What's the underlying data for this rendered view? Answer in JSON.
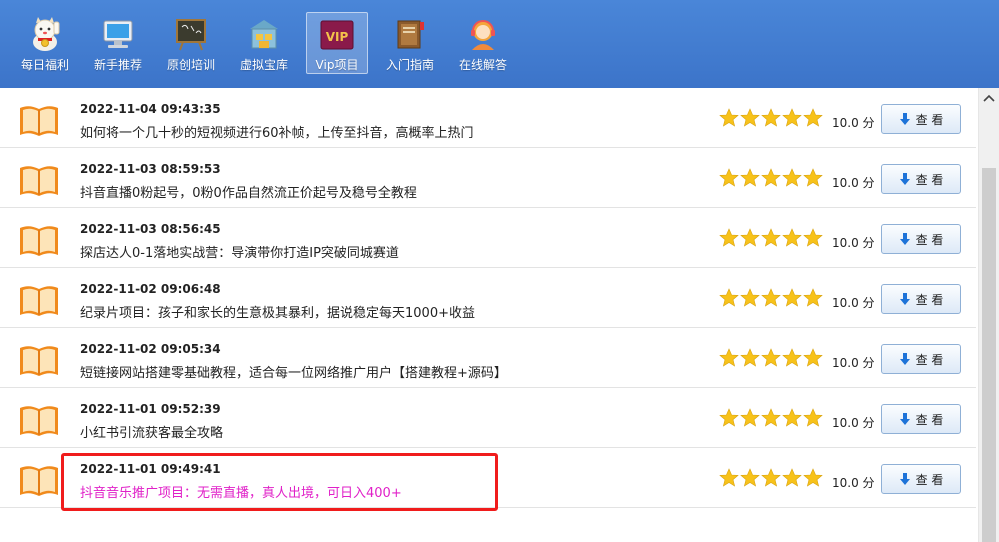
{
  "toolbar": {
    "items": [
      {
        "label": "每日福利",
        "icon": "lucky-cat-icon"
      },
      {
        "label": "新手推荐",
        "icon": "computer-icon"
      },
      {
        "label": "原创培训",
        "icon": "blackboard-icon"
      },
      {
        "label": "虚拟宝库",
        "icon": "treasury-icon"
      },
      {
        "label": "Vip项目",
        "icon": "vip-icon",
        "badge": "VIP",
        "active": true
      },
      {
        "label": "入门指南",
        "icon": "book-guide-icon"
      },
      {
        "label": "在线解答",
        "icon": "support-agent-icon"
      }
    ]
  },
  "list": {
    "rows": [
      {
        "date": "2022-11-04 09:43:35",
        "title": "如何将一个几十秒的短视频进行60补帧，上传至抖音，高概率上热门",
        "rating": 5,
        "score": "10.0 分",
        "button": "查 看"
      },
      {
        "date": "2022-11-03 08:59:53",
        "title": "抖音直播0粉起号，0粉0作品自然流正价起号及稳号全教程",
        "rating": 5,
        "score": "10.0 分",
        "button": "查 看"
      },
      {
        "date": "2022-11-03 08:56:45",
        "title": "探店达人0-1落地实战营：导演带你打造IP突破同城赛道",
        "rating": 5,
        "score": "10.0 分",
        "button": "查 看"
      },
      {
        "date": "2022-11-02 09:06:48",
        "title": "纪录片项目：孩子和家长的生意极其暴利，据说稳定每天1000+收益",
        "rating": 5,
        "score": "10.0 分",
        "button": "查 看"
      },
      {
        "date": "2022-11-02 09:05:34",
        "title": "短链接网站搭建零基础教程，适合每一位网络推广用户【搭建教程+源码】",
        "rating": 5,
        "score": "10.0 分",
        "button": "查 看"
      },
      {
        "date": "2022-11-01 09:52:39",
        "title": "小红书引流获客最全攻略",
        "rating": 5,
        "score": "10.0 分",
        "button": "查 看"
      },
      {
        "date": "2022-11-01 09:49:41",
        "title": "抖音音乐推广项目：无需直播，真人出境，可日入400+",
        "rating": 5,
        "score": "10.0 分",
        "button": "查 看",
        "highlighted": true
      }
    ]
  },
  "colors": {
    "toolbar": "#3f78cc",
    "highlight_text": "#e020c8",
    "highlight_box": "#f01c1c",
    "star": "#f7c21a",
    "book": "#f08a1c"
  }
}
